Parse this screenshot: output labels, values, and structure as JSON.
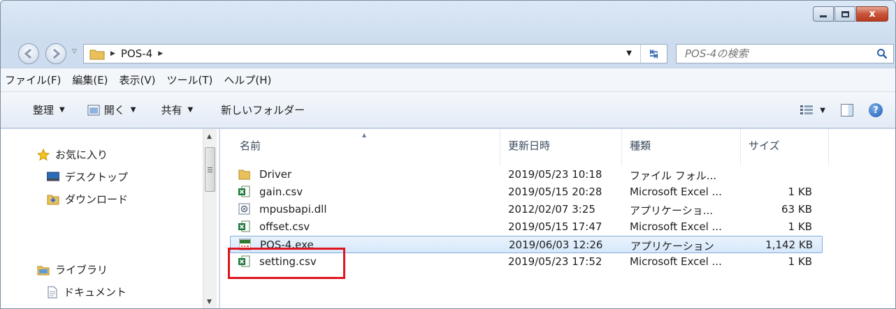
{
  "window": {
    "controls": {
      "minimize": "minimize",
      "maximize": "maximize",
      "close": "x"
    }
  },
  "address": {
    "crumbs": [
      "POS-4"
    ],
    "search_placeholder": "POS-4の検索"
  },
  "menu": [
    "ファイル(F)",
    "編集(E)",
    "表示(V)",
    "ツール(T)",
    "ヘルプ(H)"
  ],
  "commands": {
    "organize": "整理",
    "open": "開く",
    "share": "共有",
    "new_folder": "新しいフォルダー"
  },
  "nav_pane": {
    "favorites": "お気に入り",
    "desktop": "デスクトップ",
    "downloads": "ダウンロード",
    "libraries": "ライブラリ",
    "documents": "ドキュメント"
  },
  "columns": {
    "name": "名前",
    "modified": "更新日時",
    "type": "種類",
    "size": "サイズ"
  },
  "files": [
    {
      "name": "Driver",
      "modified": "2019/05/23 10:18",
      "type": "ファイル フォル...",
      "size": "",
      "icon": "folder-icon"
    },
    {
      "name": "gain.csv",
      "modified": "2019/05/15 20:28",
      "type": "Microsoft Excel ...",
      "size": "1 KB",
      "icon": "excel-csv-icon"
    },
    {
      "name": "mpusbapi.dll",
      "modified": "2012/02/07 3:25",
      "type": "アプリケーショ...",
      "size": "63 KB",
      "icon": "dll-icon"
    },
    {
      "name": "offset.csv",
      "modified": "2019/05/15 17:47",
      "type": "Microsoft Excel ...",
      "size": "1 KB",
      "icon": "excel-csv-icon"
    },
    {
      "name": "POS-4.exe",
      "modified": "2019/06/03 12:26",
      "type": "アプリケーション",
      "size": "1,142 KB",
      "icon": "pos-exe-icon",
      "selected": true
    },
    {
      "name": "setting.csv",
      "modified": "2019/05/23 17:52",
      "type": "Microsoft Excel ...",
      "size": "1 KB",
      "icon": "excel-csv-icon"
    }
  ],
  "colors": {
    "selection_border": "#84acdd",
    "highlight": "#e0141e"
  }
}
